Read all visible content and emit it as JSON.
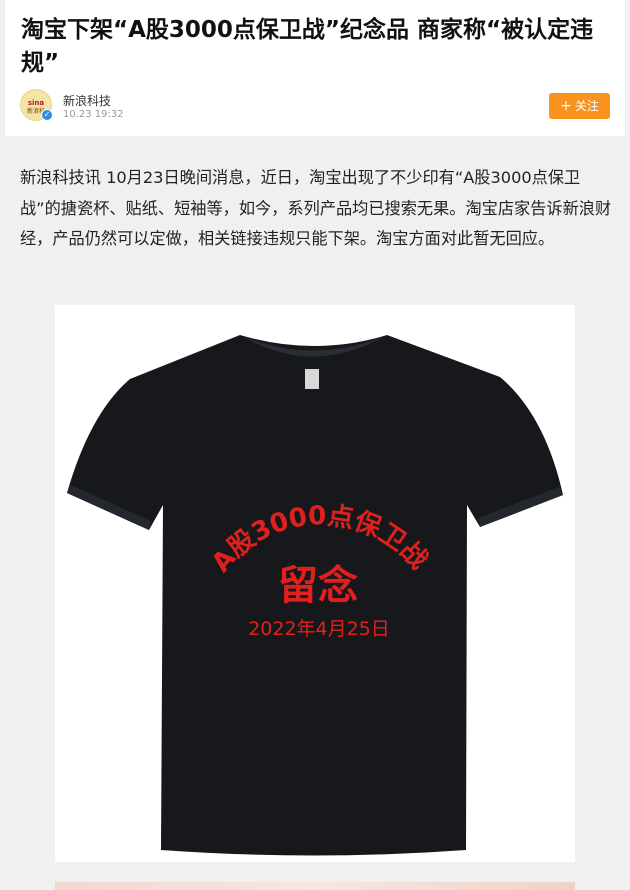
{
  "article": {
    "title": "淘宝下架“A股3000点保卫战”纪念品 商家称“被认定违规”",
    "body": "新浪科技讯 10月23日晚间消息，近日，淘宝出现了不少印有“A股3000点保卫战”的搪瓷杯、贴纸、短袖等，如今，系列产品均已搜索无果。淘宝店家告诉新浪财经，产品仍然可以定做，相关链接违规只能下架。淘宝方面对此暂无回应。"
  },
  "author": {
    "name": "新浪科技",
    "time": "10.23  19:32",
    "avatar_text": "sina",
    "avatar_sub": "新浪科"
  },
  "follow": {
    "icon": "+",
    "label": "关注"
  },
  "image": {
    "subject": "t-shirt-icon",
    "arc_text": "A股3000点保卫战",
    "center_text": "留念",
    "date_text": "2022年4月25日"
  },
  "colors": {
    "accent": "#f7931e",
    "verify": "#2b8de8",
    "print_red": "#e0201c"
  }
}
